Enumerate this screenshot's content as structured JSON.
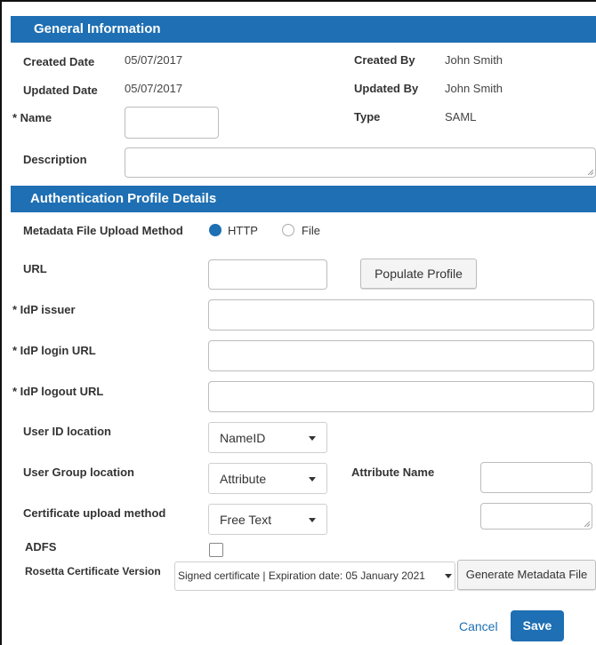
{
  "general": {
    "title": "General Information",
    "created_date_label": "Created Date",
    "created_date": "05/07/2017",
    "updated_date_label": "Updated Date",
    "updated_date": "05/07/2017",
    "created_by_label": "Created By",
    "created_by": "John Smith",
    "updated_by_label": "Updated By",
    "updated_by": "John Smith",
    "name_label": "Name",
    "name_value": "",
    "type_label": "Type",
    "type_value": "SAML",
    "description_label": "Description",
    "description_value": ""
  },
  "auth": {
    "title": "Authentication Profile Details",
    "upload_method_label": "Metadata File Upload Method",
    "upload_options": [
      "HTTP",
      "File"
    ],
    "upload_selected": "HTTP",
    "url_label": "URL",
    "url_value": "",
    "populate_button": "Populate Profile",
    "idp_issuer_label": "IdP issuer",
    "idp_login_label": "IdP login URL",
    "idp_logout_label": "IdP logout URL",
    "user_id_location_label": "User ID location",
    "user_id_location_value": "NameID",
    "user_group_location_label": "User Group location",
    "user_group_location_value": "Attribute",
    "attribute_name_label": "Attribute Name",
    "cert_upload_label": "Certificate upload method",
    "cert_upload_value": "Free Text",
    "adfs_label": "ADFS",
    "adfs_checked": false,
    "rosetta_cert_label": "Rosetta Certificate Version",
    "rosetta_cert_value": "Signed certificate | Expiration date: 05 January 2021",
    "generate_button": "Generate Metadata File"
  },
  "footer": {
    "cancel_label": "Cancel",
    "save_label": "Save"
  },
  "colors": {
    "header_bg": "#1e6fb3",
    "save_bg": "#1e6fb3",
    "link": "#1e6fb3"
  }
}
